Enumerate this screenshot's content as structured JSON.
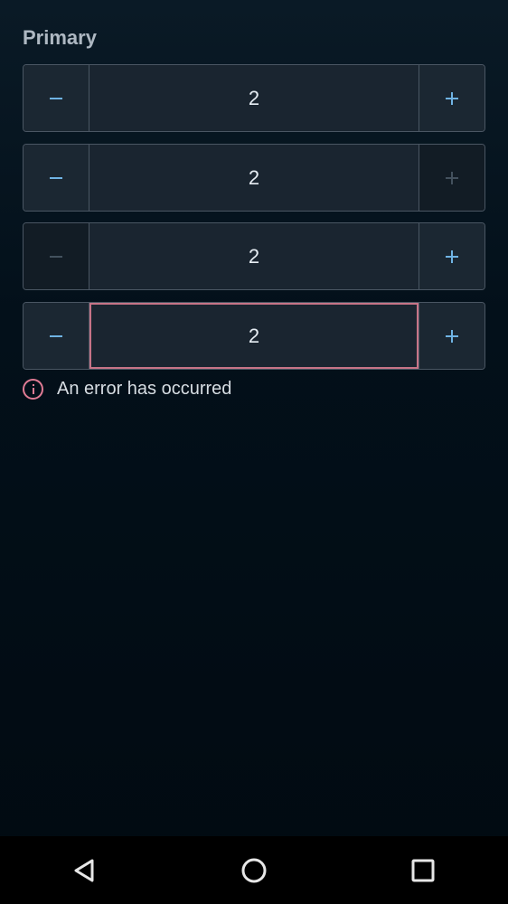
{
  "section": {
    "title": "Primary"
  },
  "steppers": [
    {
      "value": "2",
      "minus_disabled": false,
      "plus_disabled": false,
      "error": false
    },
    {
      "value": "2",
      "minus_disabled": false,
      "plus_disabled": true,
      "error": false
    },
    {
      "value": "2",
      "minus_disabled": true,
      "plus_disabled": false,
      "error": false
    },
    {
      "value": "2",
      "minus_disabled": false,
      "plus_disabled": false,
      "error": true
    }
  ],
  "error": {
    "message": "An error has occurred",
    "icon": "info-circle-icon",
    "color": "#e07b94"
  },
  "colors": {
    "background": "#020d15",
    "accent": "#6fb3e4",
    "error_border": "#c77487"
  },
  "navbar": {
    "back_icon": "back-triangle-icon",
    "home_icon": "home-circle-icon",
    "recent_icon": "recent-apps-icon"
  }
}
